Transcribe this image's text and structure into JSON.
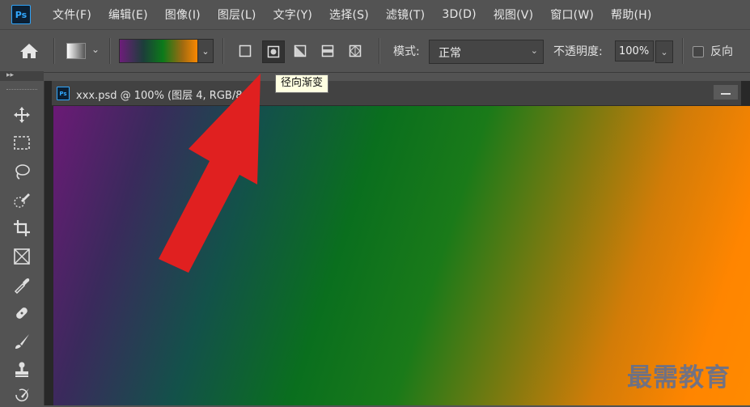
{
  "app": {
    "logo_text": "Ps"
  },
  "menu": [
    "文件(F)",
    "编辑(E)",
    "图像(I)",
    "图层(L)",
    "文字(Y)",
    "选择(S)",
    "滤镜(T)",
    "3D(D)",
    "视图(V)",
    "窗口(W)",
    "帮助(H)"
  ],
  "options": {
    "mode_label": "模式:",
    "mode_value": "正常",
    "opacity_label": "不透明度:",
    "opacity_value": "100%",
    "reverse_label": "反向",
    "gradient_types": [
      "linear-gradient-icon",
      "radial-gradient-icon",
      "angle-gradient-icon",
      "reflected-gradient-icon",
      "diamond-gradient-icon"
    ],
    "active_gradient_type": "radial-gradient-icon"
  },
  "tooltip": {
    "text": "径向渐变"
  },
  "document": {
    "tab_title": "xxx.psd @ 100% (图层 4, RGB/8#)",
    "close_glyph": "×"
  },
  "tools": [
    "move-tool-icon",
    "marquee-tool-icon",
    "lasso-tool-icon",
    "quick-select-tool-icon",
    "crop-tool-icon",
    "frame-tool-icon",
    "eyedropper-tool-icon",
    "healing-brush-tool-icon",
    "brush-tool-icon",
    "stamp-tool-icon",
    "history-brush-tool-icon"
  ],
  "colors": {
    "accent": "#31a8ff",
    "arrow": "#e02020",
    "gradient_start": "#6b1a76",
    "gradient_mid": "#0a6f1e",
    "gradient_end": "#ff8a00"
  },
  "watermark": {
    "text": "最需教育"
  }
}
